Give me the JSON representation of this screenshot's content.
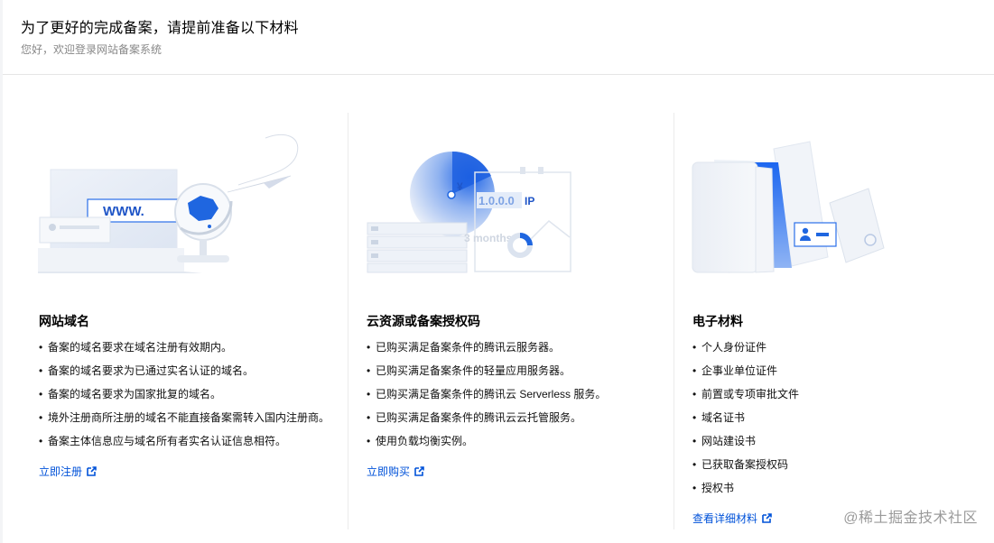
{
  "header": {
    "title": "为了更好的完成备案，请提前准备以下材料",
    "subtitle": "您好，欢迎登录网站备案系统"
  },
  "columns": [
    {
      "title": "网站域名",
      "illustration": {
        "www_text": "WWW."
      },
      "items": [
        "备案的域名要求在域名注册有效期内。",
        "备案的域名要求为已通过实名认证的域名。",
        "备案的域名要求为国家批复的域名。",
        "境外注册商所注册的域名不能直接备案需转入国内注册商。",
        "备案主体信息应与域名所有者实名认证信息相符。"
      ],
      "link": "立即注册"
    },
    {
      "title": "云资源或备案授权码",
      "illustration": {
        "currency": "¥",
        "ip_text": "1.0.0.0",
        "ip_label": "IP",
        "duration": "3 months"
      },
      "items": [
        "已购买满足备案条件的腾讯云服务器。",
        "已购买满足备案条件的轻量应用服务器。",
        "已购买满足备案条件的腾讯云 Serverless 服务。",
        "已购买满足备案条件的腾讯云云托管服务。",
        "使用负载均衡实例。"
      ],
      "link": "立即购买"
    },
    {
      "title": "电子材料",
      "items": [
        "个人身份证件",
        "企事业单位证件",
        "前置或专项审批文件",
        "域名证书",
        "网站建设书",
        "已获取备案授权码",
        "授权书"
      ],
      "link": "查看详细材料"
    }
  ],
  "bullet": "•",
  "watermark": "@稀土掘金技术社区",
  "colors": {
    "link": "#0052d9",
    "accent_blue": "#0066ff",
    "light_blue": "#e3ebf9"
  },
  "icons": {
    "external_link": "external-link-icon"
  }
}
